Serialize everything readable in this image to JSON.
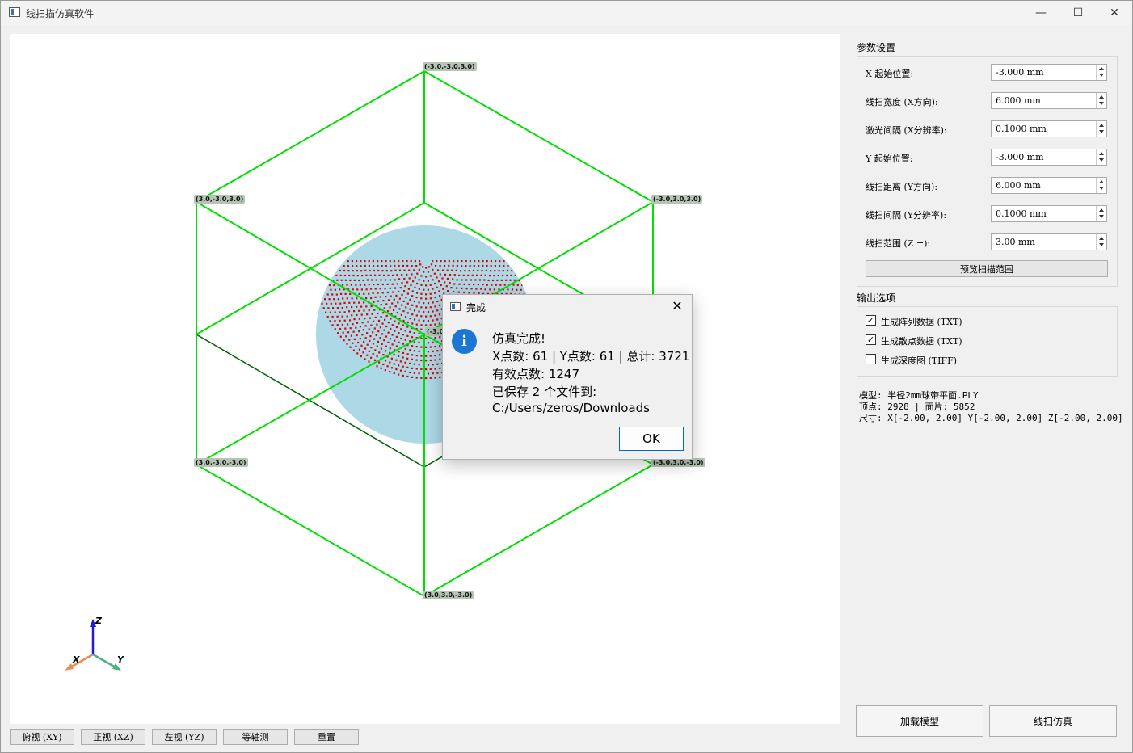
{
  "window": {
    "title": "线扫描仿真软件",
    "minimize": "—",
    "maximize": "☐",
    "close": "✕"
  },
  "viewport": {
    "vertex_labels": [
      "(-3.0,-3.0,3.0)",
      "(3.0,-3.0,3.0)",
      "(-3.0,3.0,3.0)",
      "(3.0,-3.0,-3.0)",
      "(-3.0,3.0,-3.0)",
      "(3.0,3.0,-3.0)",
      "(-3.0"
    ],
    "axes": {
      "x": "X",
      "y": "Y",
      "z": "Z"
    },
    "colors": {
      "bright_green": "#00e000",
      "dark_green": "#006400",
      "sphere": "#add8e6",
      "points": "#e00000"
    }
  },
  "view_buttons": [
    "俯视 (XY)",
    "正视 (XZ)",
    "左视 (YZ)",
    "等轴测",
    "重置"
  ],
  "params": {
    "title": "参数设置",
    "rows": [
      {
        "label": "X 起始位置:",
        "value": "-3.000 mm"
      },
      {
        "label": "线扫宽度 (X方向):",
        "value": "6.000 mm"
      },
      {
        "label": "激光间隔 (X分辨率):",
        "value": "0.1000 mm"
      },
      {
        "label": "Y 起始位置:",
        "value": "-3.000 mm"
      },
      {
        "label": "线扫距离 (Y方向):",
        "value": "6.000 mm"
      },
      {
        "label": "线扫间隔 (Y分辨率):",
        "value": "0.1000 mm"
      },
      {
        "label": "线扫范围 (Z ±):",
        "value": "3.00 mm"
      }
    ],
    "preview_button": "预览扫描范围"
  },
  "output": {
    "title": "输出选项",
    "options": [
      {
        "label": "生成阵列数据 (TXT)",
        "checked": true
      },
      {
        "label": "生成散点数据 (TXT)",
        "checked": true
      },
      {
        "label": "生成深度图 (TIFF)",
        "checked": false
      }
    ]
  },
  "model_info": {
    "line1": "模型: 半径2mm球带平面.PLY",
    "line2": "顶点: 2928 | 面片: 5852",
    "line3": "尺寸: X[-2.00, 2.00] Y[-2.00, 2.00] Z[-2.00, 2.00]"
  },
  "actions": {
    "load": "加载模型",
    "simulate": "线扫仿真"
  },
  "dialog": {
    "title": "完成",
    "close": "✕",
    "icon": "i",
    "lines": [
      "仿真完成!",
      "X点数: 61 | Y点数: 61 | 总计: 3721",
      "有效点数: 1247",
      "已保存 2 个文件到:",
      "C:/Users/zeros/Downloads"
    ],
    "ok": "OK"
  }
}
